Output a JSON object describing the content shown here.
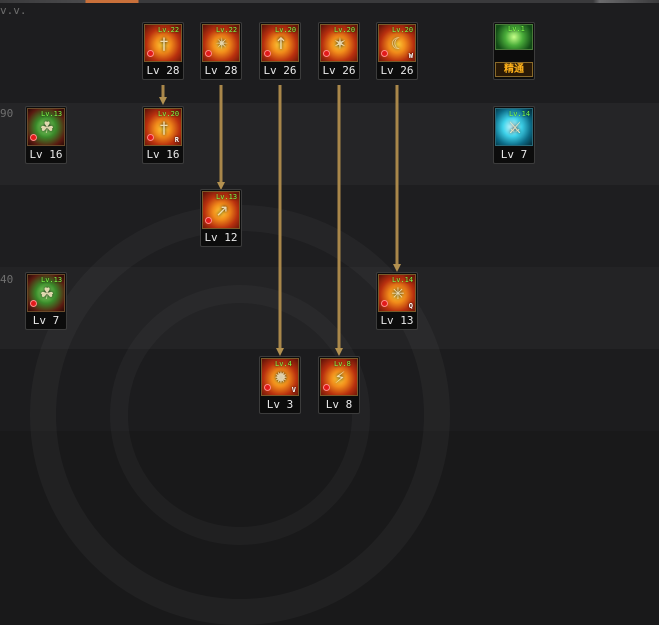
{
  "header": {
    "corner_text": "v.v."
  },
  "row_labels": {
    "row2": "90",
    "row4": "40"
  },
  "skills": [
    {
      "name": "skill-r1c1",
      "badge": "Lv.22",
      "level": "Lv 28",
      "glyph": "†",
      "letter": ""
    },
    {
      "name": "skill-r1c2",
      "badge": "Lv.22",
      "level": "Lv 28",
      "glyph": "✴",
      "letter": ""
    },
    {
      "name": "skill-r1c3",
      "badge": "Lv.20",
      "level": "Lv 26",
      "glyph": "↑",
      "letter": ""
    },
    {
      "name": "skill-r1c4",
      "badge": "Lv.20",
      "level": "Lv 26",
      "glyph": "✶",
      "letter": ""
    },
    {
      "name": "skill-r1c5",
      "badge": "Lv.20",
      "level": "Lv 26",
      "glyph": "☾",
      "letter": "W"
    },
    {
      "name": "skill-r2c0",
      "badge": "Lv.13",
      "level": "Lv 16",
      "glyph": "☘",
      "letter": ""
    },
    {
      "name": "skill-r2c1",
      "badge": "Lv.20",
      "level": "Lv 16",
      "glyph": "†",
      "letter": "R"
    },
    {
      "name": "skill-r2c6",
      "badge": "Lv.14",
      "level": "Lv 7",
      "glyph": "⚔",
      "letter": ""
    },
    {
      "name": "skill-r3c2",
      "badge": "Lv.13",
      "level": "Lv 12",
      "glyph": "↗",
      "letter": ""
    },
    {
      "name": "skill-r4c0",
      "badge": "Lv.13",
      "level": "Lv 7",
      "glyph": "☘",
      "letter": ""
    },
    {
      "name": "skill-r4c5",
      "badge": "Lv.14",
      "level": "Lv 13",
      "glyph": "✳",
      "letter": "Q"
    },
    {
      "name": "skill-r5c3",
      "badge": "Lv.4",
      "level": "Lv 3",
      "glyph": "✹",
      "letter": "V"
    },
    {
      "name": "skill-r5c4",
      "badge": "Lv.8",
      "level": "Lv 8",
      "glyph": "⚡",
      "letter": ""
    }
  ],
  "mastery": {
    "badge": "Lv.1",
    "label": "精通"
  }
}
